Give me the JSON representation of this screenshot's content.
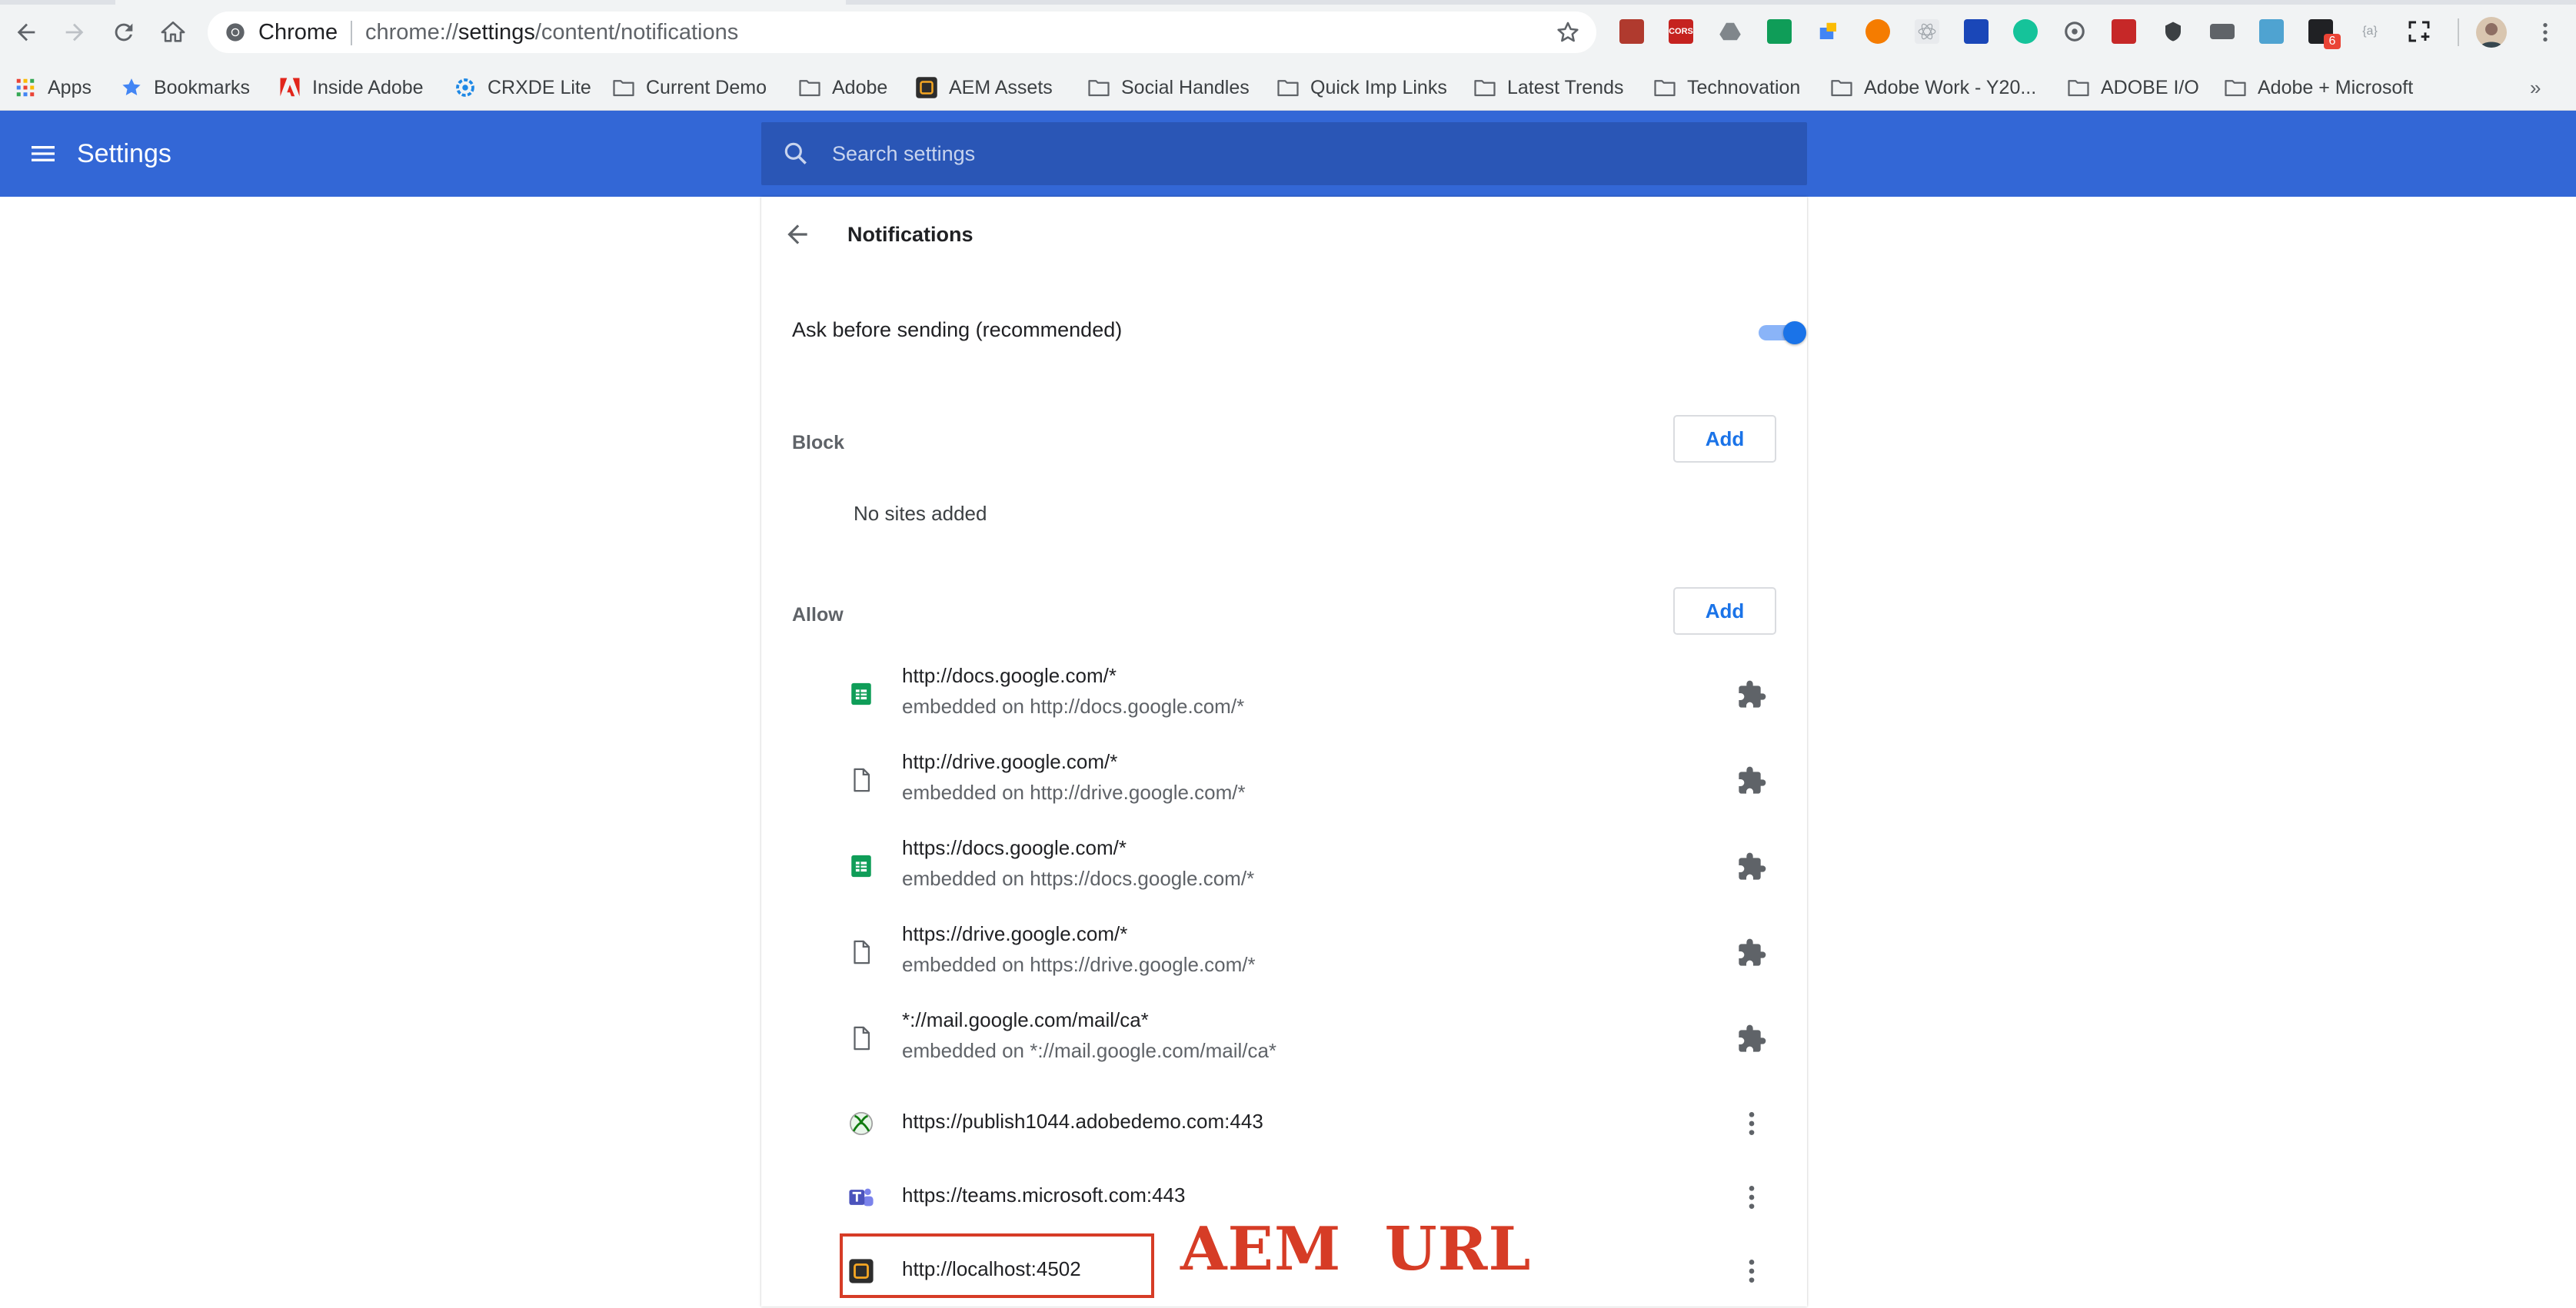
{
  "browser": {
    "omnibox": {
      "chip": "Chrome",
      "url_scheme": "chrome://",
      "url_host": "settings",
      "url_path": "/content/notifications"
    },
    "extension_badge": "6",
    "extension_labels": {
      "cors": "CORS",
      "json": "{a}"
    }
  },
  "bookmarks": [
    {
      "label": "Apps",
      "icon": "apps-grid-icon"
    },
    {
      "label": "Bookmarks",
      "icon": "star-icon"
    },
    {
      "label": "Inside Adobe",
      "icon": "adobe-icon"
    },
    {
      "label": "CRXDE Lite",
      "icon": "crxde-icon"
    },
    {
      "label": "Current Demo",
      "icon": "folder-icon"
    },
    {
      "label": "Adobe",
      "icon": "folder-icon"
    },
    {
      "label": "AEM Assets",
      "icon": "aem-icon"
    },
    {
      "label": "Social Handles",
      "icon": "folder-icon"
    },
    {
      "label": "Quick Imp Links",
      "icon": "folder-icon"
    },
    {
      "label": "Latest Trends",
      "icon": "folder-icon"
    },
    {
      "label": "Technovation",
      "icon": "folder-icon"
    },
    {
      "label": "Adobe Work - Y20...",
      "icon": "folder-icon"
    },
    {
      "label": "ADOBE I/O",
      "icon": "folder-icon"
    },
    {
      "label": "Adobe + Microsoft",
      "icon": "folder-icon"
    }
  ],
  "bookmarks_overflow": "»",
  "settings": {
    "title": "Settings",
    "search_placeholder": "Search settings"
  },
  "page": {
    "title": "Notifications",
    "ask_label": "Ask before sending (recommended)",
    "ask_enabled": true,
    "block": {
      "label": "Block",
      "add_label": "Add",
      "empty_text": "No sites added"
    },
    "allow": {
      "label": "Allow",
      "add_label": "Add",
      "sites": [
        {
          "origin": "http://docs.google.com/*",
          "embedded": "embedded on http://docs.google.com/*",
          "favicon": "sheets-icon",
          "action": "extension-puzzle-icon"
        },
        {
          "origin": "http://drive.google.com/*",
          "embedded": "embedded on http://drive.google.com/*",
          "favicon": "page-icon",
          "action": "extension-puzzle-icon"
        },
        {
          "origin": "https://docs.google.com/*",
          "embedded": "embedded on https://docs.google.com/*",
          "favicon": "sheets-icon",
          "action": "extension-puzzle-icon"
        },
        {
          "origin": "https://drive.google.com/*",
          "embedded": "embedded on https://drive.google.com/*",
          "favicon": "page-icon",
          "action": "extension-puzzle-icon"
        },
        {
          "origin": "*://mail.google.com/mail/ca*",
          "embedded": "embedded on *://mail.google.com/mail/ca*",
          "favicon": "page-icon",
          "action": "extension-puzzle-icon"
        },
        {
          "origin": "https://publish1044.adobedemo.com:443",
          "embedded": "",
          "favicon": "xbox-icon",
          "action": "more-vert-icon"
        },
        {
          "origin": "https://teams.microsoft.com:443",
          "embedded": "",
          "favicon": "teams-icon",
          "action": "more-vert-icon"
        },
        {
          "origin": "http://localhost:4502",
          "embedded": "",
          "favicon": "aem-icon",
          "action": "more-vert-icon"
        }
      ]
    }
  },
  "annotation": {
    "text": "AEM  URL",
    "color": "#d63c26"
  },
  "colors": {
    "header": "#3367d6",
    "search_bg": "#2a56b6",
    "accent": "#1a73e8",
    "toggle_track": "#8ab4f8"
  }
}
